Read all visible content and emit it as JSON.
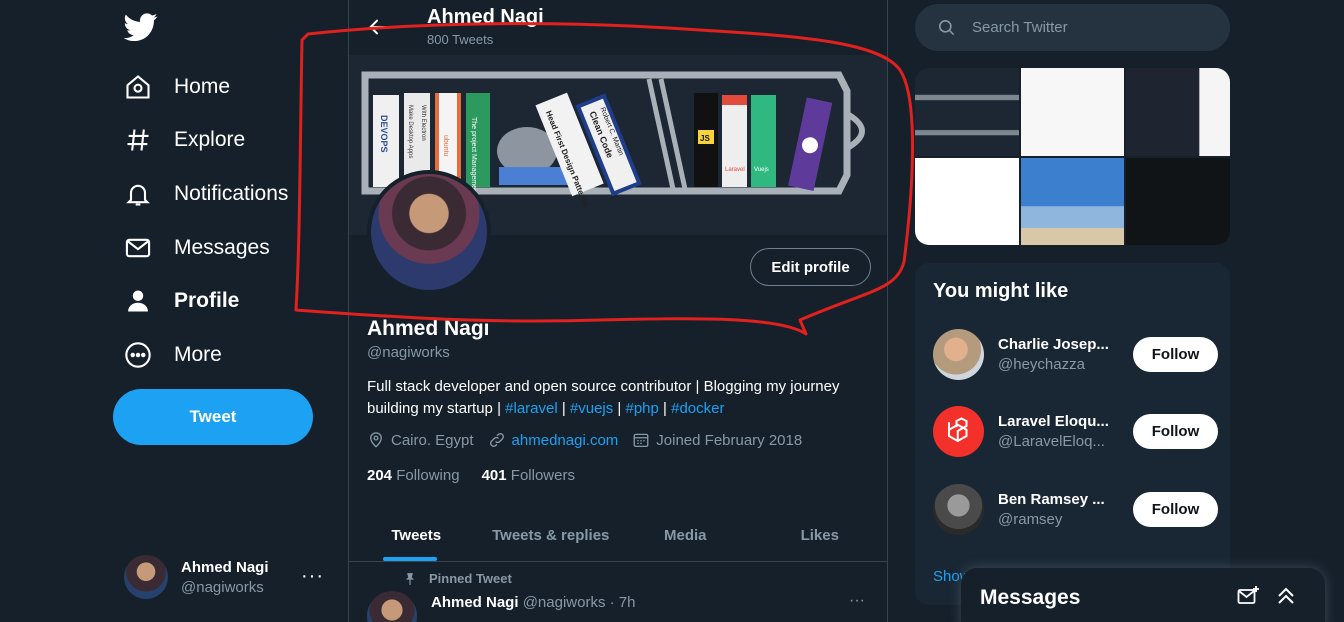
{
  "nav": {
    "home": "Home",
    "explore": "Explore",
    "notifications": "Notifications",
    "messages": "Messages",
    "profile": "Profile",
    "more": "More",
    "tweet_button": "Tweet"
  },
  "account": {
    "name": "Ahmed Nagi",
    "handle": "@nagiworks",
    "more": "···"
  },
  "header": {
    "title": "Ahmed Nagi",
    "subtitle": "800 Tweets"
  },
  "banner": {
    "books": [
      "DEVOPS",
      "Make Desktop Apps",
      "With Electron",
      "ubuntu",
      "The project Management",
      "Head First Design Patterns",
      "Clean Code",
      "Robert C. Martin",
      "JS",
      "Laravel",
      "Vuejs"
    ]
  },
  "profile": {
    "edit_button": "Edit profile",
    "name": "Ahmed Nagi",
    "handle": "@nagiworks",
    "bio_prefix": "Full stack developer and open source contributor | Blogging my journey building my startup | ",
    "hashtags": [
      "#laravel",
      "#vuejs",
      "#php",
      "#docker"
    ],
    "sep": " | ",
    "location": "Cairo. Egypt",
    "website": "ahmednagi.com",
    "joined": "Joined February 2018",
    "following_count": "204",
    "following_label": "Following",
    "followers_count": "401",
    "followers_label": "Followers"
  },
  "tabs": [
    "Tweets",
    "Tweets & replies",
    "Media",
    "Likes"
  ],
  "pinned": {
    "label": "Pinned Tweet",
    "name": "Ahmed Nagi",
    "meta": "@nagiworks · 7h",
    "more": "···"
  },
  "search": {
    "placeholder": "Search Twitter"
  },
  "who_to_follow": {
    "title": "You might like",
    "items": [
      {
        "name": "Charlie Josep...",
        "handle": "@heychazza",
        "button": "Follow"
      },
      {
        "name": "Laravel Eloqu...",
        "handle": "@LaravelEloq...",
        "button": "Follow"
      },
      {
        "name": "Ben Ramsey ...",
        "handle": "@ramsey",
        "button": "Follow"
      }
    ],
    "show_more": "Show more"
  },
  "messages_dock": {
    "title": "Messages"
  },
  "colors": {
    "background": "#15202b",
    "accent": "#1da1f2",
    "annotation": "#e0211d"
  }
}
